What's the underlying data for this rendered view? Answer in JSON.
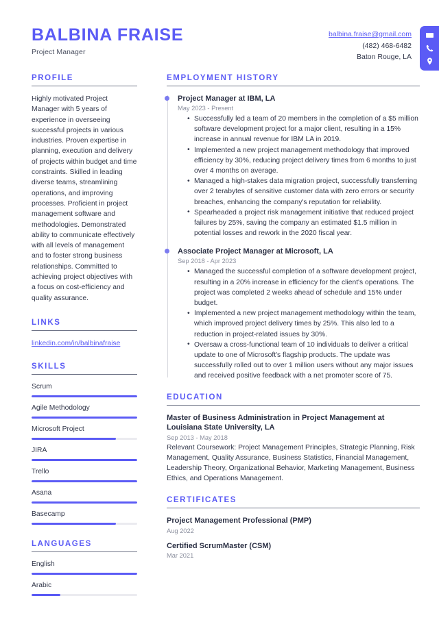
{
  "theme": {
    "accent": "#5b5bf5",
    "text": "#32374a",
    "muted": "#8b8f9e",
    "rule": "#6d7285",
    "track": "#ebebf0"
  },
  "header": {
    "name": "BALBINA FRAISE",
    "job_title": "Project Manager",
    "email": "balbina.fraise@gmail.com",
    "phone": "(482) 468-6482",
    "location": "Baton Rouge, LA",
    "icons": [
      "envelope-icon",
      "phone-icon",
      "location-pin-icon"
    ]
  },
  "sidebar": {
    "profile": {
      "heading": "PROFILE",
      "text": "Highly motivated Project Manager with 5 years of experience in overseeing successful projects in various industries. Proven expertise in planning, execution and delivery of projects within budget and time constraints. Skilled in leading diverse teams, streamlining operations, and improving processes. Proficient in project management software and methodologies. Demonstrated ability to communicate effectively with all levels of management and to foster strong business relationships. Committed to achieving project objectives with a focus on cost-efficiency and quality assurance."
    },
    "links": {
      "heading": "LINKS",
      "items": [
        {
          "label": "linkedin.com/in/balbinafraise"
        }
      ]
    },
    "skills": {
      "heading": "SKILLS",
      "items": [
        {
          "label": "Scrum",
          "level": 100
        },
        {
          "label": "Agile Methodology",
          "level": 100
        },
        {
          "label": "Microsoft Project",
          "level": 80
        },
        {
          "label": "JIRA",
          "level": 100
        },
        {
          "label": "Trello",
          "level": 100
        },
        {
          "label": "Asana",
          "level": 100
        },
        {
          "label": "Basecamp",
          "level": 80
        }
      ]
    },
    "languages": {
      "heading": "LANGUAGES",
      "items": [
        {
          "label": "English",
          "level": 100
        },
        {
          "label": "Arabic",
          "level": 27
        }
      ]
    }
  },
  "main": {
    "employment": {
      "heading": "EMPLOYMENT HISTORY",
      "jobs": [
        {
          "title": "Project Manager at IBM, LA",
          "dates": "May 2023 - Present",
          "bullets": [
            "Successfully led a team of 20 members in the completion of a $5 million software development project for a major client, resulting in a 15% increase in annual revenue for IBM LA in 2019.",
            "Implemented a new project management methodology that improved efficiency by 30%, reducing project delivery times from 6 months to just over 4 months on average.",
            "Managed a high-stakes data migration project, successfully transferring over 2 terabytes of sensitive customer data with zero errors or security breaches, enhancing the company's reputation for reliability.",
            "Spearheaded a project risk management initiative that reduced project failures by 25%, saving the company an estimated $1.5 million in potential losses and rework in the 2020 fiscal year."
          ]
        },
        {
          "title": "Associate Project Manager at Microsoft, LA",
          "dates": "Sep 2018 - Apr 2023",
          "bullets": [
            "Managed the successful completion of a software development project, resulting in a 20% increase in efficiency for the client's operations. The project was completed 2 weeks ahead of schedule and 15% under budget.",
            "Implemented a new project management methodology within the team, which improved project delivery times by 25%. This also led to a reduction in project-related issues by 30%.",
            "Oversaw a cross-functional team of 10 individuals to deliver a critical update to one of Microsoft's flagship products. The update was successfully rolled out to over 1 million users without any major issues and received positive feedback with a net promoter score of 75."
          ]
        }
      ]
    },
    "education": {
      "heading": "EDUCATION",
      "entries": [
        {
          "title": "Master of Business Administration in Project Management at Louisiana State University, LA",
          "dates": "Sep 2013 - May 2018",
          "description": "Relevant Coursework: Project Management Principles, Strategic Planning, Risk Management, Quality Assurance, Business Statistics, Financial Management, Leadership Theory, Organizational Behavior, Marketing Management, Business Ethics, and Operations Management."
        }
      ]
    },
    "certificates": {
      "heading": "CERTIFICATES",
      "entries": [
        {
          "title": "Project Management Professional (PMP)",
          "dates": "Aug 2022"
        },
        {
          "title": "Certified ScrumMaster (CSM)",
          "dates": "Mar 2021"
        }
      ]
    }
  }
}
